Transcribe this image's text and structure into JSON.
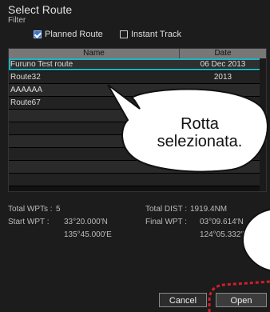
{
  "dialog": {
    "title": "Select Route"
  },
  "filter": {
    "label": "Filter",
    "planned_route": {
      "label": "Planned Route",
      "checked": true
    },
    "instant_track": {
      "label": "Instant Track",
      "checked": false
    }
  },
  "table": {
    "headers": {
      "name": "Name",
      "date": "Date"
    },
    "rows": [
      {
        "name": "Furuno Test route",
        "date": "06 Dec 2013"
      },
      {
        "name": "Route32",
        "date": "2013"
      },
      {
        "name": "AAAAAA",
        "date": ""
      },
      {
        "name": "Route67",
        "date": ""
      },
      {
        "name": "",
        "date": ""
      },
      {
        "name": "",
        "date": ""
      },
      {
        "name": "",
        "date": ""
      },
      {
        "name": "",
        "date": ""
      },
      {
        "name": "",
        "date": ""
      },
      {
        "name": "",
        "date": ""
      }
    ]
  },
  "summary": {
    "total_wpts_label": "Total WPTs :",
    "total_wpts": "5",
    "total_dist_label": "Total DIST :",
    "total_dist": "1919.4NM",
    "start_wpt_label": "Start WPT :",
    "start_wpt_lat": "33°20.000'N",
    "start_wpt_lon": "135°45.000'E",
    "final_wpt_label": "Final WPT :",
    "final_wpt_lat": "03°09.614'N",
    "final_wpt_lon": "124°05.332'E"
  },
  "buttons": {
    "cancel": "Cancel",
    "open": "Open"
  },
  "callout": {
    "text": "Rotta selezionata."
  },
  "colors": {
    "selection": "#1fb5c3",
    "highlight": "#d0202a"
  }
}
